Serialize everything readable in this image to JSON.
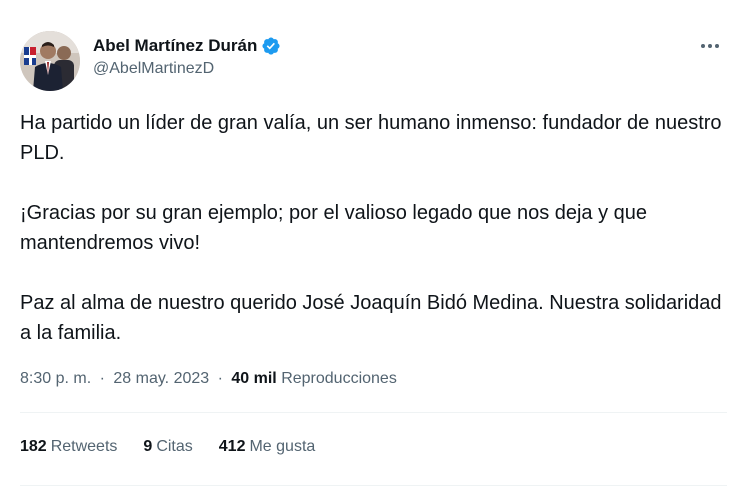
{
  "author": {
    "display_name": "Abel Martínez Durán",
    "handle": "@AbelMartinezD",
    "verified_icon": "verified-badge-icon",
    "verified_color": "#1d9bf0"
  },
  "tweet": {
    "paragraphs": [
      "Ha partido un líder de gran valía, un ser humano inmenso: fundador de nuestro PLD.",
      "¡Gracias por su gran ejemplo; por el valioso legado que nos deja y que mantendremos vivo!",
      "Paz al alma de nuestro querido José Joaquín Bidó Medina. Nuestra solidaridad a la familia."
    ]
  },
  "meta": {
    "time": "8:30 p. m.",
    "separator": "·",
    "date": "28 may. 2023",
    "views_count": "40 mil",
    "views_label": "Reproducciones"
  },
  "stats": {
    "retweets_count": "182",
    "retweets_label": "Retweets",
    "quotes_count": "9",
    "quotes_label": "Citas",
    "likes_count": "412",
    "likes_label": "Me gusta"
  },
  "colors": {
    "text": "#0f1419",
    "secondary": "#536471",
    "divider": "#eff3f4"
  }
}
